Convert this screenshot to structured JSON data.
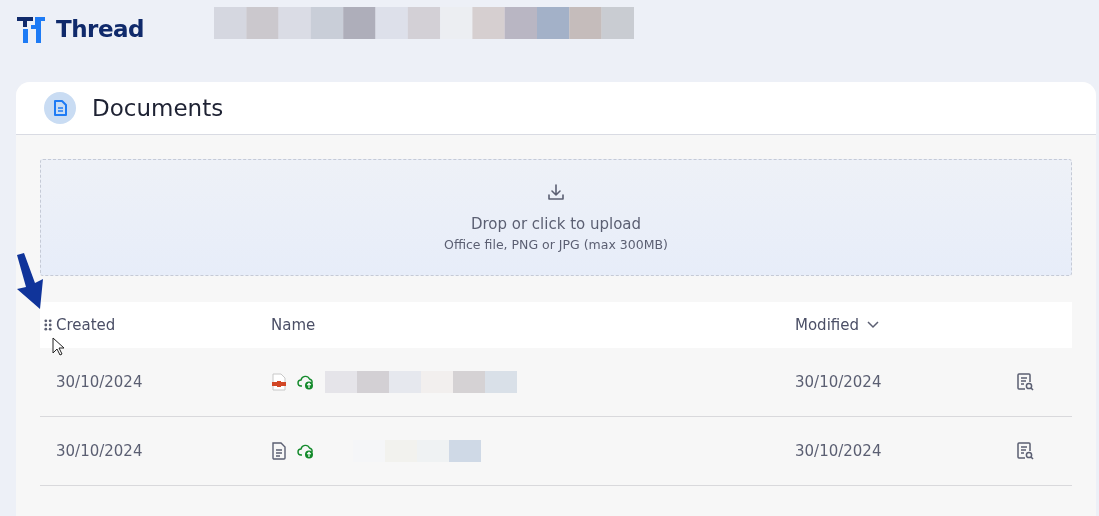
{
  "brand": "Thread",
  "page": {
    "title": "Documents"
  },
  "upload": {
    "title": "Drop or click to upload",
    "hint": "Office file, PNG or JPG (max 300MB)"
  },
  "table": {
    "columns": [
      {
        "label": "Created",
        "sorted": false
      },
      {
        "label": "Name",
        "sorted": false
      },
      {
        "label": "Modified",
        "sorted": true
      }
    ],
    "rows": [
      {
        "created": "30/10/2024",
        "kind": "pdf",
        "modified": "30/10/2024"
      },
      {
        "created": "30/10/2024",
        "kind": "text",
        "modified": "30/10/2024"
      }
    ]
  }
}
